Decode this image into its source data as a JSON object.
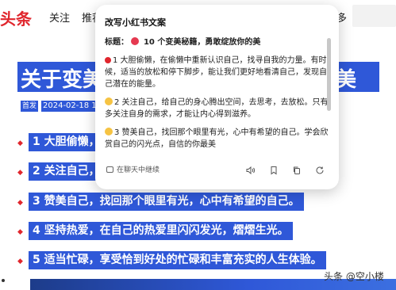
{
  "topbar": {
    "logo": "头条",
    "nav_follow": "关注",
    "nav_recommend": "推荐",
    "nav_more": "多"
  },
  "article": {
    "headline_left": "关于变美",
    "headline_right": "美",
    "meta_tag": "首发",
    "date": "2024-02-18 1",
    "paragraphs": [
      "1 大胆偷懒，",
      "2 关注自己，",
      "3 赞美自己，找回那个眼里有光，心中有希望的自己。",
      "4 坚持热爱，在自己的热爱里闪闪发光，熠熠生光。",
      "5 适当忙碌，享受恰到好处的忙碌和丰富充实的人生体验。"
    ],
    "bullet_glyph": "◆",
    "watermark": "头条 @空小楼"
  },
  "popup": {
    "header": "改写小红书文案",
    "title_prefix": "标题：",
    "title_text": "10 个变美秘籍，勇敢绽放你的美",
    "p1": "1 大胆偷懒，在偷懒中重新认识自己，找寻自我的力量。有时候，适当的放松和停下脚步，能让我们更好地看清自己，发现自己潜在的能量。",
    "p2": "2 关注自己，给自己的身心腾出空间，去思考，去放松。只有多关注自身的需求，才能让内心得到滋养。",
    "p3": "3 赞美自己，找回那个眼里有光，心中有希望的自己。学会欣赏自己的闪光点，自信的你最美",
    "continue_label": "在聊天中继续",
    "tools": [
      "speaker-icon",
      "bookmark-icon",
      "copy-icon",
      "refresh-icon"
    ]
  }
}
